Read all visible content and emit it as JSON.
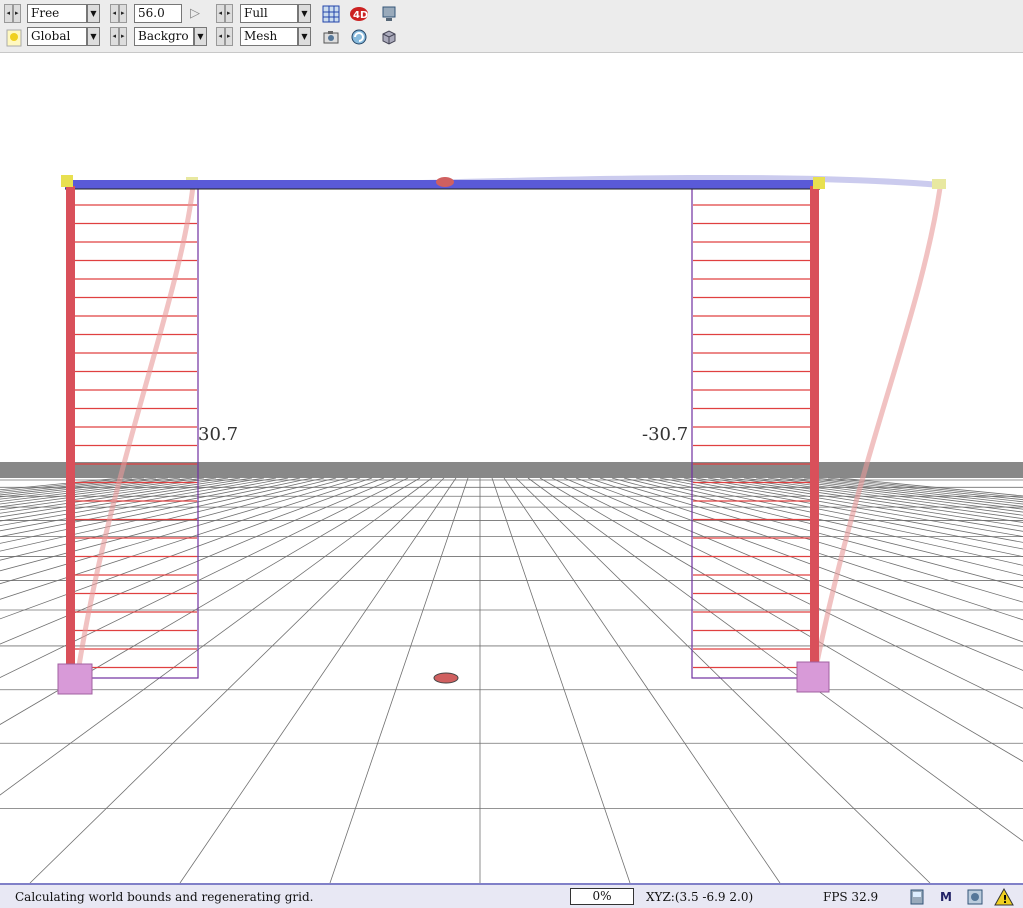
{
  "toolbar": {
    "camera_mode": "Free",
    "angle_value": "56.0",
    "render_mode": "Full",
    "coord_system": "Global",
    "background": "Backgro",
    "display": "Mesh"
  },
  "viewport": {
    "left_label": "30.7",
    "right_label": "-30.7"
  },
  "status": {
    "message": "Calculating world bounds and regenerating grid.",
    "progress": "0%",
    "xyz": "XYZ:(3.5  -6.9  2.0)",
    "fps": "FPS   32.9",
    "m_label": "M"
  },
  "colors": {
    "beam": "#5a5ad8",
    "column": "#d9505a",
    "diagram": "#e04040",
    "node": "#e8e050",
    "support": "#d89ad8"
  },
  "icons": [
    "play-icon",
    "grid-icon",
    "4d-icon",
    "monitor-icon",
    "light-bulb-icon",
    "camera-icon",
    "rotate-icon",
    "cube-icon",
    "printer-icon",
    "m-icon",
    "screen-icon",
    "warning-icon"
  ]
}
